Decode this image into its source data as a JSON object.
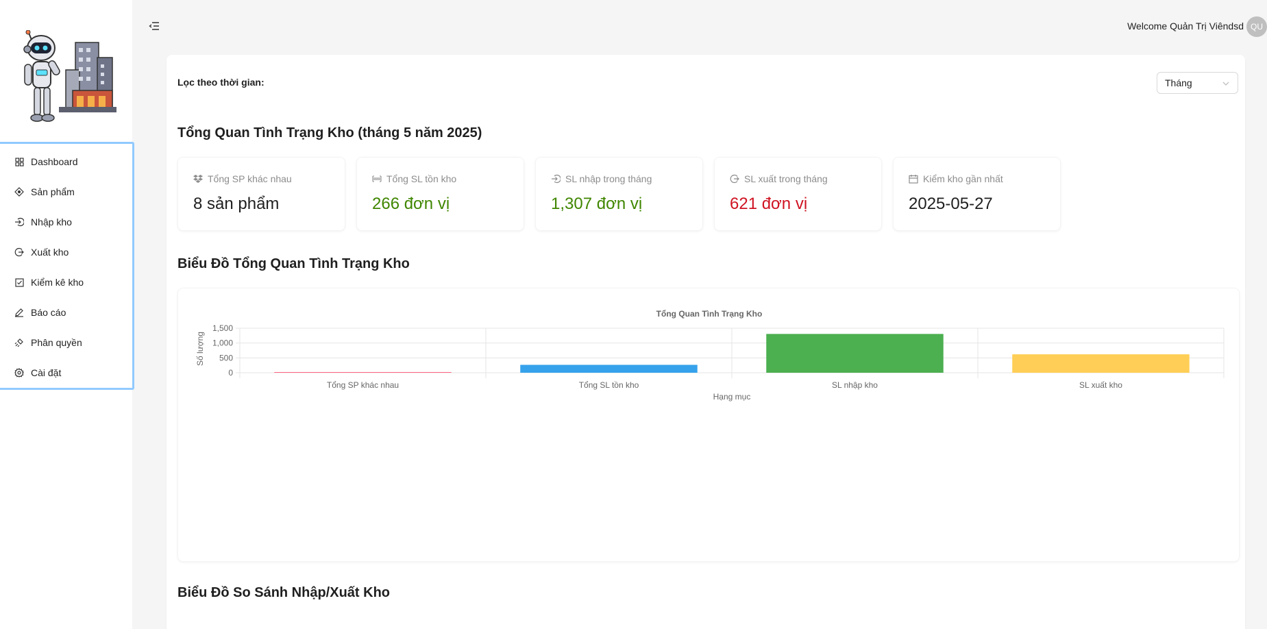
{
  "sidebar": {
    "items": [
      {
        "label": "Dashboard",
        "icon": "dashboard-icon"
      },
      {
        "label": "Sản phẩm",
        "icon": "product-icon"
      },
      {
        "label": "Nhập kho",
        "icon": "import-icon"
      },
      {
        "label": "Xuất kho",
        "icon": "export-icon"
      },
      {
        "label": "Kiểm kê kho",
        "icon": "check-square-icon"
      },
      {
        "label": "Báo cáo",
        "icon": "edit-icon"
      },
      {
        "label": "Phân quyền",
        "icon": "api-icon"
      },
      {
        "label": "Cài đặt",
        "icon": "gear-icon"
      }
    ]
  },
  "header": {
    "welcome": "Welcome Quản Trị Viêndsd",
    "avatar_text": "QU"
  },
  "filter": {
    "label": "Lọc theo thời gian:",
    "selected": "Tháng"
  },
  "overview": {
    "title": "Tổng Quan Tình Trạng Kho (tháng 5 năm 2025)",
    "stats": [
      {
        "title": "Tổng SP khác nhau",
        "value": "8 sản phẩm",
        "color": "#1f1f1f",
        "icon": "dropbox-icon"
      },
      {
        "title": "Tổng SL tồn kho",
        "value": "266 đơn vị",
        "color": "#3f8600",
        "icon": "barcode-icon"
      },
      {
        "title": "SL nhập trong tháng",
        "value": "1,307 đơn vị",
        "color": "#3f8600",
        "icon": "login-icon"
      },
      {
        "title": "SL xuất trong tháng",
        "value": "621 đơn vị",
        "color": "#cf1322",
        "icon": "logout-icon"
      },
      {
        "title": "Kiểm kho gần nhất",
        "value": "2025-05-27",
        "color": "#1f1f1f",
        "icon": "calendar-icon"
      }
    ]
  },
  "chart_section": {
    "title": "Biểu Đồ Tổng Quan Tình Trạng Kho"
  },
  "compare_section": {
    "title": "Biểu Đồ So Sánh Nhập/Xuất Kho"
  },
  "chart_data": {
    "type": "bar",
    "title": "Tổng Quan Tình Trạng Kho",
    "xlabel": "Hạng mục",
    "ylabel": "Số lượng",
    "ylim": [
      0,
      1500
    ],
    "yticks": [
      0,
      500,
      1000,
      1500
    ],
    "ytick_labels": [
      "0",
      "500",
      "1,000",
      "1,500"
    ],
    "grid": true,
    "categories": [
      "Tổng SP khác nhau",
      "Tổng SL tồn kho",
      "SL nhập kho",
      "SL xuất kho"
    ],
    "values": [
      8,
      266,
      1307,
      621
    ],
    "colors": [
      "#ff6384",
      "#36a2eb",
      "#4caf50",
      "#ffce56"
    ]
  }
}
